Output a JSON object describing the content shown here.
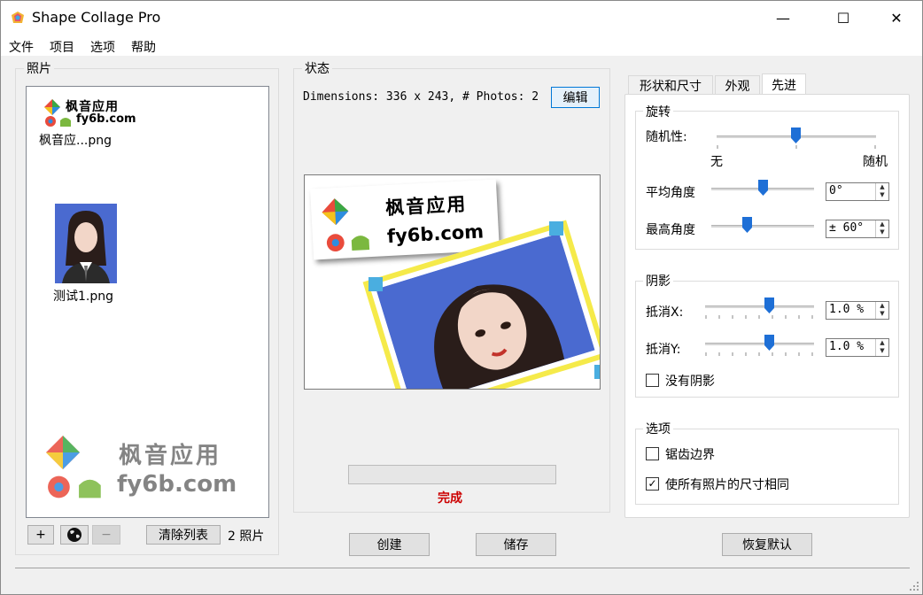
{
  "window": {
    "title": "Shape Collage Pro",
    "minimize": "—",
    "maximize": "☐",
    "close": "✕"
  },
  "menu": [
    "文件",
    "项目",
    "选项",
    "帮助"
  ],
  "photos": {
    "label": "照片",
    "items": [
      {
        "name": "枫音应...png",
        "logo_line1": "枫音应用",
        "logo_line2": "fy6b.com"
      },
      {
        "name": "测试1.png"
      }
    ],
    "watermark_line1": "枫音应用",
    "watermark_line2": "fy6b.com",
    "add_label": "+",
    "globe_icon": "globe-icon",
    "remove_label": "−",
    "clear_label": "清除列表",
    "count_label": "2 照片"
  },
  "status": {
    "label": "状态",
    "dimensions": "Dimensions: 336 x 243, # Photos: 2",
    "edit_label": "编辑",
    "preview_logo_line1": "枫音应用",
    "preview_logo_line2": "fy6b.com",
    "progress": 0,
    "done_label": "完成",
    "done_color": "#cc0000"
  },
  "actions": {
    "create_label": "创建",
    "save_label": "储存",
    "reset_label": "恢复默认"
  },
  "tabs": [
    {
      "label": "形状和尺寸",
      "active": false
    },
    {
      "label": "外观",
      "active": false
    },
    {
      "label": "先进",
      "active": true
    }
  ],
  "rotation": {
    "label": "旋转",
    "randomness_label": "随机性:",
    "randomness_min": "无",
    "randomness_max": "随机",
    "randomness_level": 0.5,
    "avg_angle_label": "平均角度",
    "avg_angle_value": "0°",
    "max_angle_label": "最高角度",
    "max_angle_value": "± 60°"
  },
  "shadow": {
    "label": "阴影",
    "offset_x_label": "抵消X:",
    "offset_x_value": "1.0 %",
    "offset_y_label": "抵消Y:",
    "offset_y_value": "1.0 %",
    "no_shadow_label": "没有阴影",
    "no_shadow_checked": false
  },
  "options": {
    "label": "选项",
    "aliased_label": "锯齿边界",
    "aliased_checked": false,
    "same_size_label": "使所有照片的尺寸相同",
    "same_size_checked": true
  },
  "colors": {
    "accent": "#0078d7",
    "thumb": "#1e6fd6",
    "frame_yellow": "#f5ea4a",
    "corner_blue": "#4aaee0",
    "photo_bg": "#4a6ad0"
  }
}
